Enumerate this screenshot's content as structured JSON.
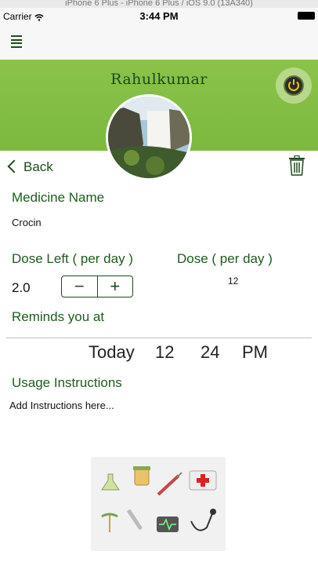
{
  "simulator_title": "iPhone 6 Plus - iPhone 6 Plus / iOS 9.0 (13A340)",
  "status_bar": {
    "carrier": "Carrier",
    "time": "3:44 PM"
  },
  "profile": {
    "name": "Rahulkumar"
  },
  "nav": {
    "back_label": "Back"
  },
  "medicine": {
    "label": "Medicine Name",
    "value": "Crocin"
  },
  "dose_left": {
    "label": "Dose Left ( per day )",
    "value": "2.0",
    "minus": "−",
    "plus": "+"
  },
  "dose": {
    "label": "Dose ( per day )",
    "value": "12"
  },
  "reminder": {
    "label": "Reminds you at",
    "day": "Today",
    "hour": "12",
    "minute": "24",
    "ampm": "PM"
  },
  "usage": {
    "label": "Usage Instructions",
    "placeholder": "Add Instructions here..."
  },
  "colors": {
    "banner_green": "#8bc34a",
    "text_green": "#1e5c1e"
  },
  "icons": [
    "menu-icon",
    "power-icon",
    "back-chevron-icon",
    "trash-icon",
    "wifi-icon",
    "battery-icon"
  ]
}
